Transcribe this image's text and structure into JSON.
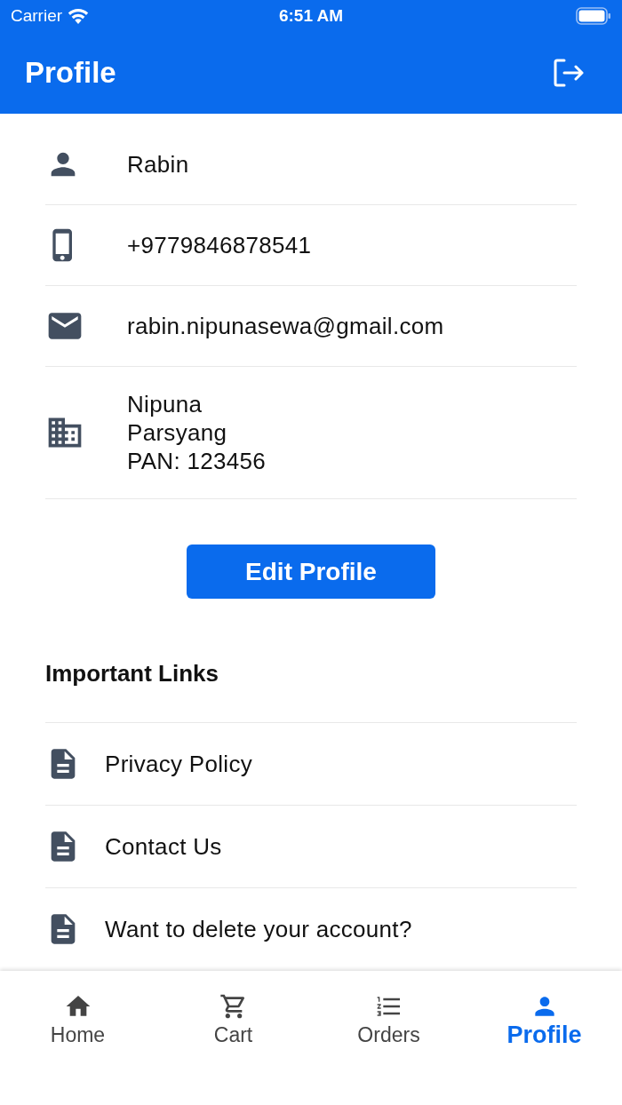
{
  "status_bar": {
    "carrier": "Carrier",
    "time": "6:51 AM"
  },
  "header": {
    "title": "Profile"
  },
  "profile_fields": [
    {
      "kind": "person",
      "lines": [
        "Rabin"
      ]
    },
    {
      "kind": "phone",
      "lines": [
        "+9779846878541"
      ]
    },
    {
      "kind": "email",
      "lines": [
        "rabin.nipunasewa@gmail.com"
      ]
    },
    {
      "kind": "company",
      "lines": [
        "Nipuna",
        "Parsyang",
        "PAN: 123456"
      ]
    }
  ],
  "edit_button": {
    "label": "Edit Profile"
  },
  "links_section": {
    "title": "Important Links",
    "links": [
      {
        "label": "Privacy Policy"
      },
      {
        "label": "Contact Us"
      },
      {
        "label": "Want to delete your account?"
      }
    ]
  },
  "bottom_nav": [
    {
      "kind": "home",
      "label": "Home",
      "selected": false
    },
    {
      "kind": "cart",
      "label": "Cart",
      "selected": false
    },
    {
      "kind": "orders",
      "label": "Orders",
      "selected": false
    },
    {
      "kind": "profile",
      "label": "Profile",
      "selected": true
    }
  ]
}
